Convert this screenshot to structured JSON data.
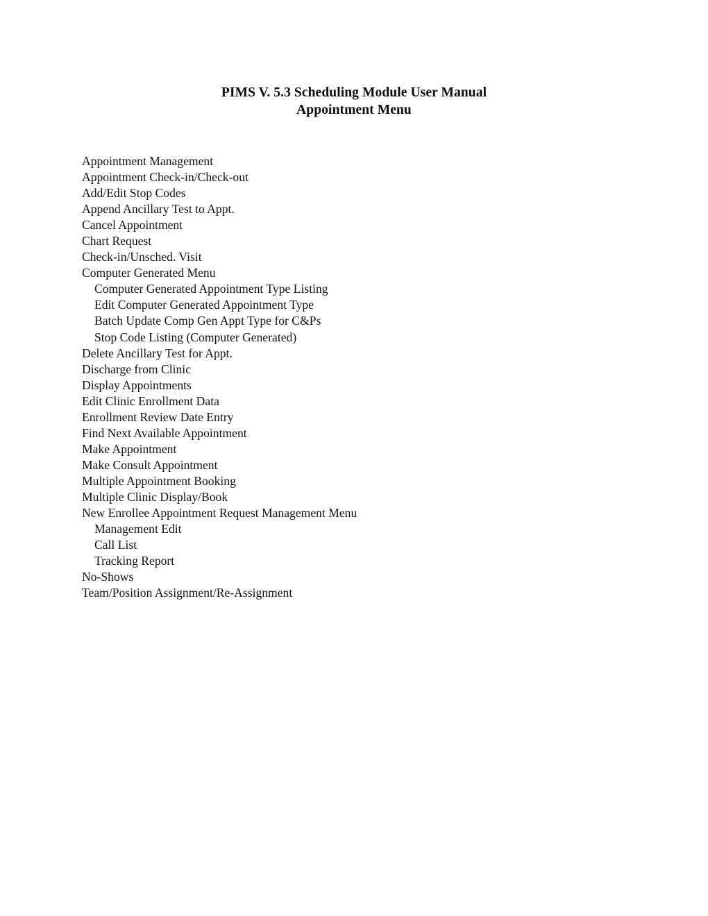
{
  "document": {
    "title_lines": [
      "PIMS V. 5.3 Scheduling Module User Manual",
      "Appointment Menu"
    ],
    "menu_items": [
      {
        "label": "Appointment Management",
        "level": 1
      },
      {
        "label": "Appointment Check-in/Check-out",
        "level": 1
      },
      {
        "label": "Add/Edit Stop Codes",
        "level": 1
      },
      {
        "label": "Append Ancillary Test to Appt.",
        "level": 1
      },
      {
        "label": "Cancel Appointment",
        "level": 1
      },
      {
        "label": "Chart Request",
        "level": 1
      },
      {
        "label": "Check-in/Unsched. Visit",
        "level": 1
      },
      {
        "label": "Computer Generated Menu",
        "level": 1
      },
      {
        "label": "Computer Generated Appointment Type Listing",
        "level": 2
      },
      {
        "label": "Edit Computer Generated Appointment Type",
        "level": 2
      },
      {
        "label": "Batch Update Comp Gen Appt Type for C&Ps",
        "level": 2
      },
      {
        "label": "Stop Code Listing (Computer Generated)",
        "level": 2
      },
      {
        "label": "Delete Ancillary Test for Appt.",
        "level": 1
      },
      {
        "label": "Discharge from Clinic",
        "level": 1
      },
      {
        "label": "Display Appointments",
        "level": 1
      },
      {
        "label": "Edit Clinic Enrollment Data",
        "level": 1
      },
      {
        "label": "Enrollment Review Date Entry",
        "level": 1
      },
      {
        "label": "Find Next Available Appointment",
        "level": 1
      },
      {
        "label": "Make Appointment",
        "level": 1
      },
      {
        "label": "Make Consult Appointment",
        "level": 1
      },
      {
        "label": "Multiple Appointment Booking",
        "level": 1
      },
      {
        "label": "Multiple Clinic Display/Book",
        "level": 1
      },
      {
        "label": "New Enrollee Appointment Request Management Menu",
        "level": 1
      },
      {
        "label": "Management Edit",
        "level": 2
      },
      {
        "label": "Call List",
        "level": 2
      },
      {
        "label": "Tracking Report",
        "level": 2
      },
      {
        "label": "No-Shows",
        "level": 1
      },
      {
        "label": "Team/Position Assignment/Re-Assignment",
        "level": 1
      }
    ]
  },
  "colors": {
    "page_background": "#ffffff",
    "text": "#141313"
  }
}
